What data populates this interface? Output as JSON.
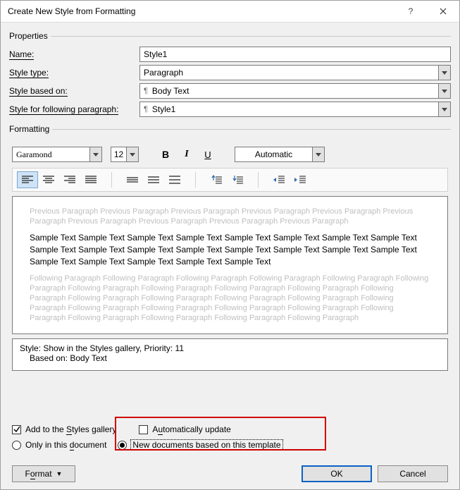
{
  "titlebar": {
    "title": "Create New Style from Formatting"
  },
  "groups": {
    "properties": "Properties",
    "formatting": "Formatting"
  },
  "labels": {
    "name_pre": "",
    "name_u": "N",
    "name_post": "ame:",
    "styletype_pre": "Style ",
    "styletype_u": "t",
    "styletype_post": "ype:",
    "basedon_pre": "Style ",
    "basedon_u": "b",
    "basedon_post": "ased on:",
    "following_pre": "",
    "following_u": "S",
    "following_post": "tyle for following paragraph:"
  },
  "fields": {
    "name": "Style1",
    "styletype": "Paragraph",
    "basedon": "Body Text",
    "following": "Style1"
  },
  "format": {
    "font": "Garamond",
    "size": "12",
    "bold": "B",
    "italic": "I",
    "underline": "U",
    "auto": "Automatic"
  },
  "preview": {
    "ghost_prev": "Previous Paragraph Previous Paragraph Previous Paragraph Previous Paragraph Previous Paragraph Previous Paragraph Previous Paragraph Previous Paragraph Previous Paragraph Previous Paragraph",
    "sample": "Sample Text Sample Text Sample Text Sample Text Sample Text Sample Text Sample Text Sample Text Sample Text Sample Text Sample Text Sample Text Sample Text Sample Text Sample Text Sample Text Sample Text Sample Text Sample Text Sample Text Sample Text",
    "ghost_next": "Following Paragraph Following Paragraph Following Paragraph Following Paragraph Following Paragraph Following Paragraph Following Paragraph Following Paragraph Following Paragraph Following Paragraph Following Paragraph Following Paragraph Following Paragraph Following Paragraph Following Paragraph Following Paragraph Following Paragraph Following Paragraph Following Paragraph Following Paragraph Following Paragraph Following Paragraph Following Paragraph Following Paragraph Following Paragraph"
  },
  "desc": {
    "line1": "Style: Show in the Styles gallery, Priority: 11",
    "line2": "Based on: Body Text"
  },
  "options": {
    "addgallery_pre": "Add to the ",
    "addgallery_u": "S",
    "addgallery_post": "tyles gallery",
    "autoupdate_pre": "A",
    "autoupdate_u": "u",
    "autoupdate_post": "tomatically update",
    "onlydoc_pre": "Only in this ",
    "onlydoc_u": "d",
    "onlydoc_post": "ocument",
    "newdocs": "New documents based on this template",
    "addgallery_checked": true,
    "autoupdate_checked": false,
    "newdocs_selected": true
  },
  "buttons": {
    "format_pre": "F",
    "format_u": "o",
    "format_post": "rmat",
    "ok": "OK",
    "cancel": "Cancel"
  }
}
